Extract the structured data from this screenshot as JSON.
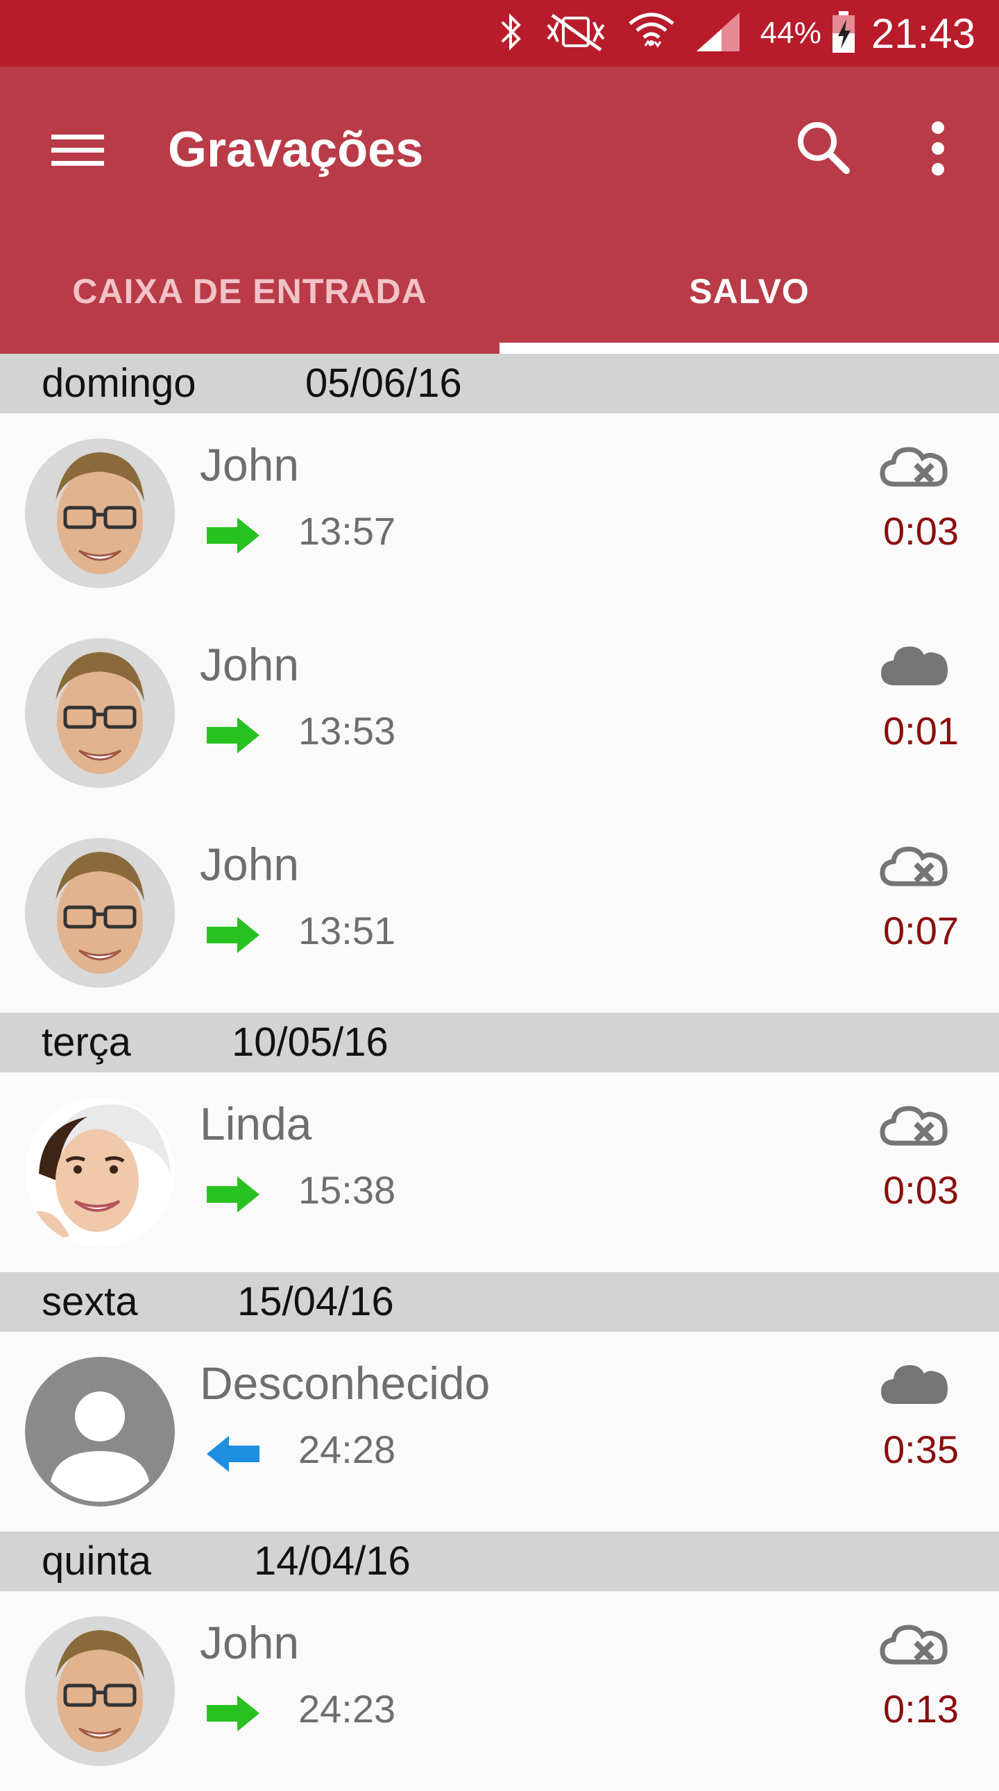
{
  "status_bar": {
    "battery_percent": "44%",
    "time": "21:43",
    "icons": [
      "bluetooth-icon",
      "vibrate-mute-icon",
      "wifi-icon",
      "signal-icon",
      "battery-charging-icon"
    ]
  },
  "app_bar": {
    "title": "Gravações",
    "icons": [
      "menu-icon",
      "search-icon",
      "more-vert-icon"
    ]
  },
  "tabs": [
    {
      "label": "CAIXA DE ENTRADA",
      "selected": false
    },
    {
      "label": "SALVO",
      "selected": true
    }
  ],
  "colors": {
    "status_bar": "#b81c2b",
    "app_bar": "#b93b48",
    "outgoing_arrow": "#27c21f",
    "incoming_arrow": "#1e8fe0",
    "duration_text": "#8b0d0d"
  },
  "groups": [
    {
      "day": "domingo",
      "date": "05/06/16",
      "items": [
        {
          "name": "John",
          "time": "13:57",
          "duration": "0:03",
          "direction": "outgoing",
          "cloud": "cloud-off-icon",
          "avatar": "male"
        },
        {
          "name": "John",
          "time": "13:53",
          "duration": "0:01",
          "direction": "outgoing",
          "cloud": "cloud-icon",
          "avatar": "male"
        },
        {
          "name": "John",
          "time": "13:51",
          "duration": "0:07",
          "direction": "outgoing",
          "cloud": "cloud-off-icon",
          "avatar": "male"
        }
      ]
    },
    {
      "day": "terça",
      "date": "10/05/16",
      "items": [
        {
          "name": "Linda",
          "time": "15:38",
          "duration": "0:03",
          "direction": "outgoing",
          "cloud": "cloud-off-icon",
          "avatar": "female"
        }
      ]
    },
    {
      "day": "sexta",
      "date": "15/04/16",
      "items": [
        {
          "name": "Desconhecido",
          "time": "24:28",
          "duration": "0:35",
          "direction": "incoming",
          "cloud": "cloud-icon",
          "avatar": "unknown"
        }
      ]
    },
    {
      "day": "quinta",
      "date": "14/04/16",
      "items": [
        {
          "name": "John",
          "time": "24:23",
          "duration": "0:13",
          "direction": "outgoing",
          "cloud": "cloud-off-icon",
          "avatar": "male"
        }
      ]
    }
  ]
}
